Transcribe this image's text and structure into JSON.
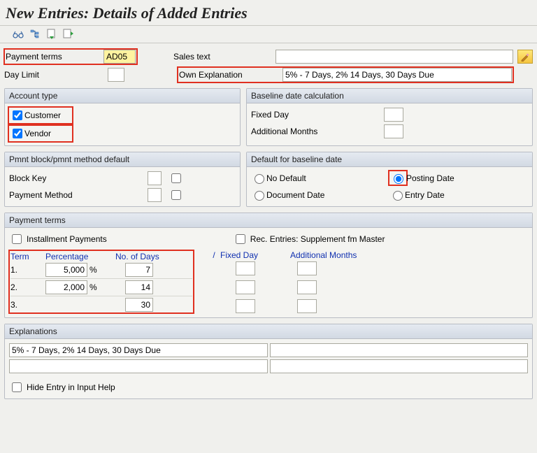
{
  "title": "New Entries: Details of Added Entries",
  "header": {
    "payment_terms_label": "Payment terms",
    "payment_terms_value": "AD05",
    "sales_text_label": "Sales text",
    "sales_text_value": "",
    "day_limit_label": "Day Limit",
    "day_limit_value": "",
    "own_explanation_label": "Own Explanation",
    "own_explanation_value": "5% - 7 Days, 2% 14 Days, 30 Days Due"
  },
  "account_type": {
    "title": "Account type",
    "customer_label": "Customer",
    "customer_checked": true,
    "vendor_label": "Vendor",
    "vendor_checked": true
  },
  "baseline_calc": {
    "title": "Baseline date calculation",
    "fixed_day_label": "Fixed Day",
    "fixed_day_value": "",
    "add_months_label": "Additional Months",
    "add_months_value": ""
  },
  "pmnt_block": {
    "title": "Pmnt block/pmnt method default",
    "block_key_label": "Block Key",
    "block_key_value": "",
    "payment_method_label": "Payment Method",
    "payment_method_value": ""
  },
  "default_baseline": {
    "title": "Default for baseline date",
    "no_default": "No Default",
    "posting_date": "Posting Date",
    "document_date": "Document Date",
    "entry_date": "Entry Date",
    "selected": "posting_date"
  },
  "payment_terms": {
    "title": "Payment terms",
    "installment_label": "Installment Payments",
    "rec_entries_label": "Rec. Entries: Supplement fm Master",
    "headers": {
      "term": "Term",
      "percentage": "Percentage",
      "days": "No. of Days",
      "slash": "/",
      "fixed": "Fixed Day",
      "months": "Additional Months"
    },
    "rows": [
      {
        "term": "1.",
        "percentage": "5,000",
        "pct_sign": "%",
        "days": "7"
      },
      {
        "term": "2.",
        "percentage": "2,000",
        "pct_sign": "%",
        "days": "14"
      },
      {
        "term": "3.",
        "percentage": "",
        "pct_sign": "",
        "days": "30"
      }
    ]
  },
  "explanations": {
    "title": "Explanations",
    "line1": "5% - 7 Days, 2% 14 Days, 30 Days Due",
    "hide_label": "Hide Entry in Input Help"
  }
}
